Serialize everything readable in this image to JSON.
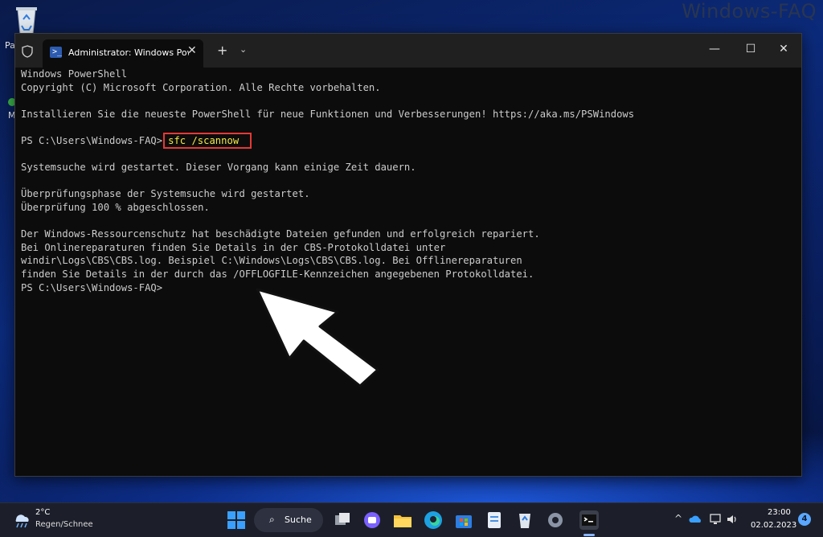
{
  "desktop": {
    "watermark": "Windows-FAQ",
    "recycle_label": "Pa",
    "second_label": "M"
  },
  "window": {
    "tab_title": "Administrator: Windows PowerShell",
    "new_tab": "+",
    "dropdown": "⌄",
    "minimize": "—",
    "maximize": "☐",
    "close": "✕",
    "tab_close": "✕",
    "tab_icon": ">_"
  },
  "terminal": {
    "lines": [
      "Windows PowerShell",
      "Copyright (C) Microsoft Corporation. Alle Rechte vorbehalten.",
      "",
      "Installieren Sie die neueste PowerShell für neue Funktionen und Verbesserungen! https://aka.ms/PSWindows",
      "",
      "",
      "",
      "Systemsuche wird gestartet. Dieser Vorgang kann einige Zeit dauern.",
      "",
      "Überprüfungsphase der Systemsuche wird gestartet.",
      "Überprüfung 100 % abgeschlossen.",
      "",
      "Der Windows-Ressourcenschutz hat beschädigte Dateien gefunden und erfolgreich repariert.",
      "Bei Onlinereparaturen finden Sie Details in der CBS-Protokolldatei unter",
      "windir\\Logs\\CBS\\CBS.log. Beispiel C:\\Windows\\Logs\\CBS\\CBS.log. Bei Offlinereparaturen",
      "finden Sie Details in der durch das /OFFLOGFILE-Kennzeichen angegebenen Protokolldatei.",
      "PS C:\\Users\\Windows-FAQ>"
    ],
    "prompt": "PS C:\\Users\\Windows-FAQ>",
    "command": "sfc /scannow"
  },
  "taskbar": {
    "temperature": "2°C",
    "condition": "Regen/Schnee",
    "search_label": "Suche",
    "time": "23:00",
    "date": "02.02.2023",
    "notification_count": "4",
    "tray_chevron": "^"
  },
  "colors": {
    "command": "#f4e84a",
    "highlight_box": "#e53935",
    "terminal_text": "#cccccc"
  }
}
